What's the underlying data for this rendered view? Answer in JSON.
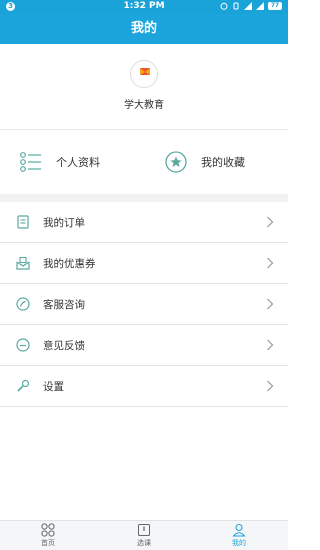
{
  "status_bar": {
    "time": "1:32 PM",
    "notification": "3",
    "battery": "77"
  },
  "header": {
    "title": "我的"
  },
  "profile": {
    "logo_text": "学大教育",
    "name": "学大教育"
  },
  "quick_links": [
    {
      "label": "个人资料",
      "icon": "list-icon"
    },
    {
      "label": "我的收藏",
      "icon": "star-icon"
    }
  ],
  "menu": [
    {
      "label": "我的订单",
      "icon": "order-icon"
    },
    {
      "label": "我的优惠券",
      "icon": "coupon-icon"
    },
    {
      "label": "客服咨询",
      "icon": "chat-icon"
    },
    {
      "label": "意见反馈",
      "icon": "feedback-icon"
    },
    {
      "label": "设置",
      "icon": "wrench-icon"
    }
  ],
  "tabs": [
    {
      "label": "首页",
      "icon": "home-grid-icon",
      "active": false
    },
    {
      "label": "选课",
      "icon": "book-icon",
      "active": false
    },
    {
      "label": "我的",
      "icon": "person-icon",
      "active": true
    }
  ],
  "colors": {
    "primary": "#1ba5dc",
    "icon_teal": "#5aa9a0",
    "text": "#333333"
  }
}
